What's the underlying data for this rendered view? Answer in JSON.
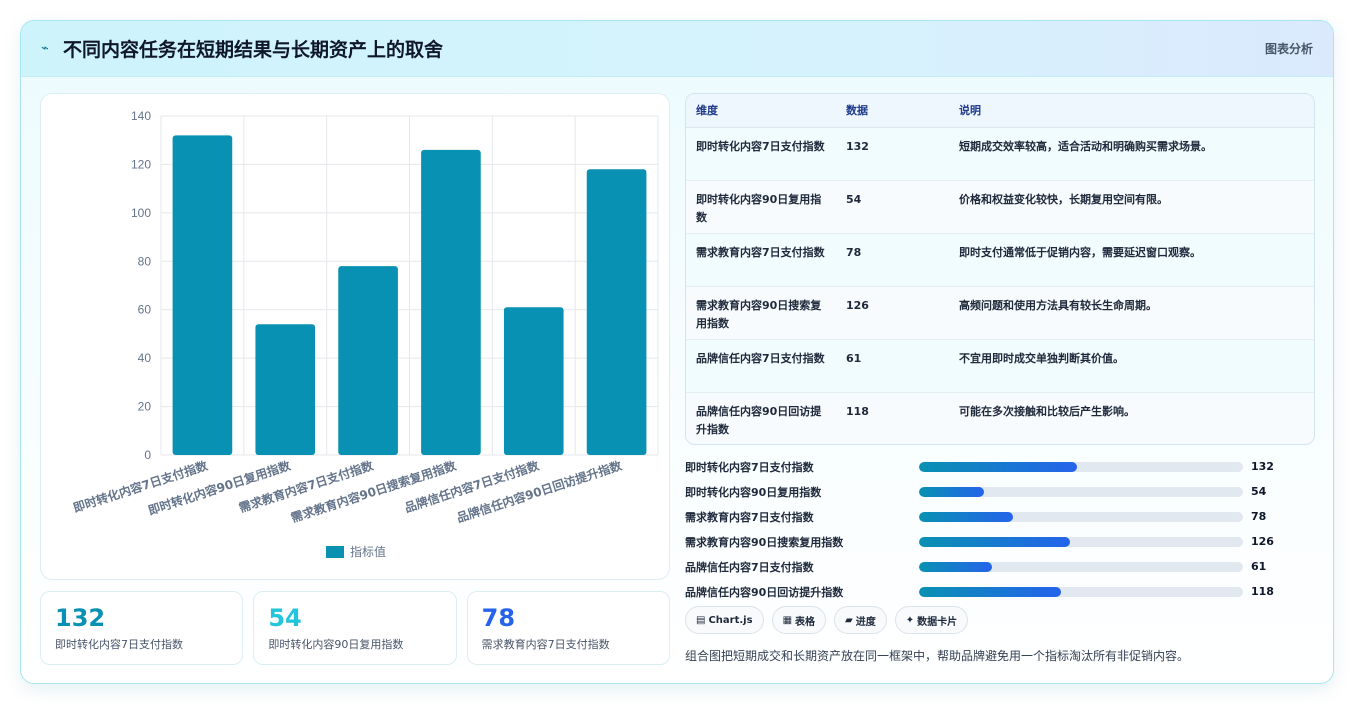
{
  "header": {
    "icon": "trend-icon",
    "title": "不同内容任务在短期结果与长期资产上的取舍",
    "tag": "图表分析"
  },
  "chart_data": {
    "type": "bar",
    "categories": [
      "即时转化内容7日支付指数",
      "即时转化内容90日复用指数",
      "需求教育内容7日支付指数",
      "需求教育内容90日搜索复用指数",
      "品牌信任内容7日支付指数",
      "品牌信任内容90日回访提升指数"
    ],
    "series": [
      {
        "name": "指标值",
        "values": [
          132,
          54,
          78,
          126,
          61,
          118
        ]
      }
    ],
    "ylim": [
      0,
      140
    ],
    "yticks": [
      "0",
      "20",
      "40",
      "60",
      "80",
      "100",
      "120",
      "140"
    ],
    "grid": true,
    "legend": "bottom",
    "bar_color": "#0891b2"
  },
  "kpis": [
    {
      "value": "132",
      "label": "即时转化内容7日支付指数",
      "color": "#0891b2"
    },
    {
      "value": "54",
      "label": "即时转化内容90日复用指数",
      "color": "#22c5dc"
    },
    {
      "value": "78",
      "label": "需求教育内容7日支付指数",
      "color": "#2563eb"
    }
  ],
  "table": {
    "headers": [
      "维度",
      "数据",
      "说明"
    ],
    "rows": [
      {
        "dim": "即时转化内容7日支付指数",
        "value": "132",
        "desc": "短期成交效率较高，适合活动和明确购买需求场景。"
      },
      {
        "dim": "即时转化内容90日复用指数",
        "value": "54",
        "desc": "价格和权益变化较快，长期复用空间有限。"
      },
      {
        "dim": "需求教育内容7日支付指数",
        "value": "78",
        "desc": "即时支付通常低于促销内容，需要延迟窗口观察。"
      },
      {
        "dim": "需求教育内容90日搜索复用指数",
        "value": "126",
        "desc": "高频问题和使用方法具有较长生命周期。"
      },
      {
        "dim": "品牌信任内容7日支付指数",
        "value": "61",
        "desc": "不宜用即时成交单独判断其价值。"
      },
      {
        "dim": "品牌信任内容90日回访提升指数",
        "value": "118",
        "desc": "可能在多次接触和比较后产生影响。"
      }
    ]
  },
  "progress": [
    {
      "label": "即时转化内容7日支付指数",
      "value": "132",
      "fraction": 0.4889
    },
    {
      "label": "即时转化内容90日复用指数",
      "value": "54",
      "fraction": 0.2
    },
    {
      "label": "需求教育内容7日支付指数",
      "value": "78",
      "fraction": 0.2889
    },
    {
      "label": "需求教育内容90日搜索复用指数",
      "value": "126",
      "fraction": 0.4667
    },
    {
      "label": "品牌信任内容7日支付指数",
      "value": "61",
      "fraction": 0.2259
    },
    {
      "label": "品牌信任内容90日回访提升指数",
      "value": "118",
      "fraction": 0.437
    }
  ],
  "chips": [
    {
      "icon": "chart-icon",
      "glyph": "▤",
      "label": "Chart.js"
    },
    {
      "icon": "table-icon",
      "glyph": "▦",
      "label": "表格"
    },
    {
      "icon": "progress-icon",
      "glyph": "▰",
      "label": "进度"
    },
    {
      "icon": "sparkle-icon",
      "glyph": "✦",
      "label": "数据卡片"
    }
  ],
  "note": "组合图把短期成交和长期资产放在同一框架中，帮助品牌避免用一个指标淘汰所有非促销内容。"
}
